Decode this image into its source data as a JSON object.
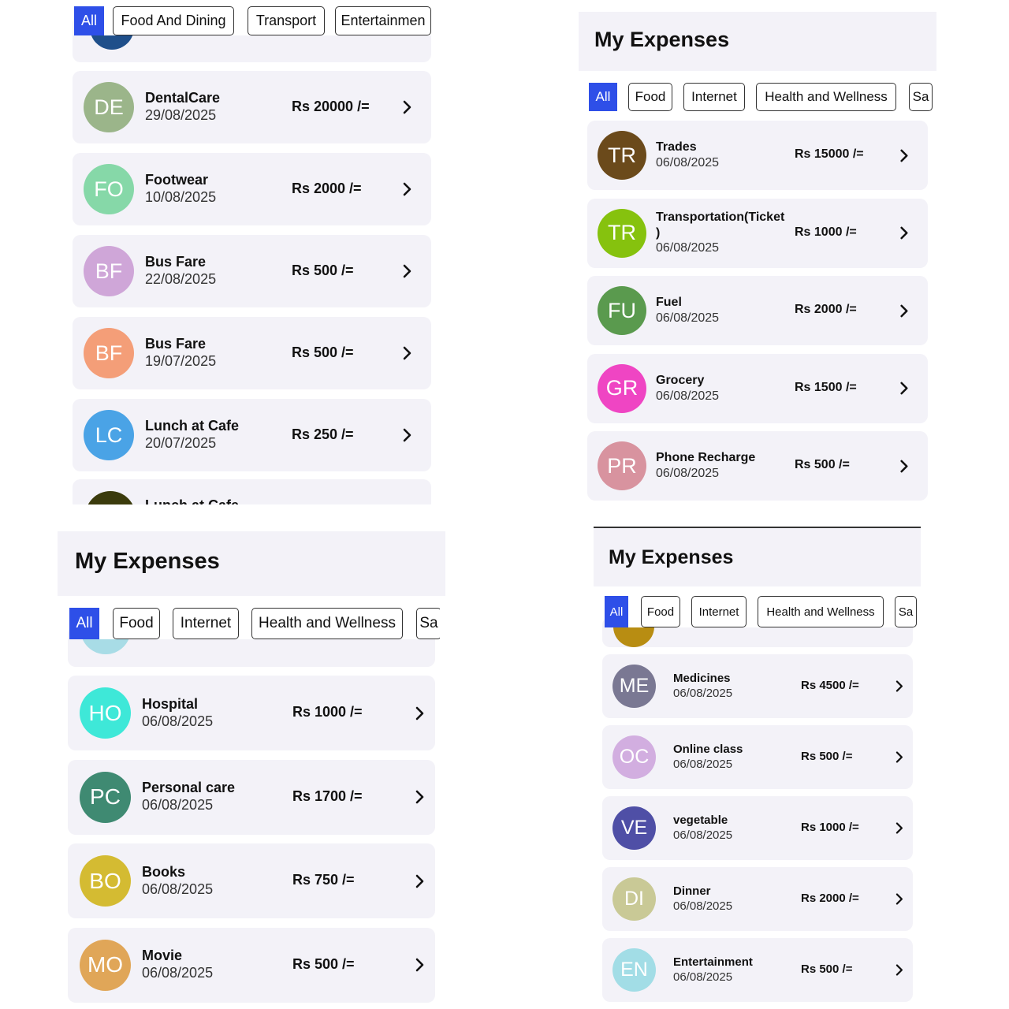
{
  "panel_tl": {
    "filters": [
      {
        "label": "All",
        "active": true
      },
      {
        "label": "Food And Dining",
        "active": false
      },
      {
        "label": "Transport",
        "active": false
      },
      {
        "label": "Entertainmen",
        "active": false
      }
    ],
    "partial_top": {
      "initials": "",
      "color": "#1f4f8a"
    },
    "items": [
      {
        "initials": "DE",
        "color": "#9bb58a",
        "title": "DentalCare",
        "date": "29/08/2025",
        "amount": "Rs 20000 /="
      },
      {
        "initials": "FO",
        "color": "#86d8a8",
        "title": "Footwear",
        "date": "10/08/2025",
        "amount": "Rs 2000 /="
      },
      {
        "initials": "BF",
        "color": "#cfa6d8",
        "title": "Bus Fare",
        "date": "22/08/2025",
        "amount": "Rs 500 /="
      },
      {
        "initials": "BF",
        "color": "#f49e78",
        "title": "Bus Fare",
        "date": "19/07/2025",
        "amount": "Rs 500 /="
      },
      {
        "initials": "LC",
        "color": "#4aa3e6",
        "title": "Lunch at Cafe",
        "date": "20/07/2025",
        "amount": "Rs 250 /="
      }
    ],
    "partial_bottom": {
      "initials": "",
      "color": "#3b3b0c",
      "title": "Lunch at Cafe"
    }
  },
  "panel_tr": {
    "title": "My Expenses",
    "filters": [
      {
        "label": "All",
        "active": true
      },
      {
        "label": "Food",
        "active": false
      },
      {
        "label": "Internet",
        "active": false
      },
      {
        "label": "Health and Wellness",
        "active": false
      },
      {
        "label": "Sa",
        "active": false
      }
    ],
    "items": [
      {
        "initials": "TR",
        "color": "#6b4a1b",
        "title": "Trades",
        "date": "06/08/2025",
        "amount": "Rs 15000 /="
      },
      {
        "initials": "TR",
        "color": "#86c20e",
        "title": "Transportation(Ticket\n)",
        "date": "06/08/2025",
        "amount": "Rs 1000 /="
      },
      {
        "initials": "FU",
        "color": "#5a9a4e",
        "title": "Fuel",
        "date": "06/08/2025",
        "amount": "Rs 2000 /="
      },
      {
        "initials": "GR",
        "color": "#ef45c3",
        "title": "Grocery",
        "date": "06/08/2025",
        "amount": "Rs 1500 /="
      },
      {
        "initials": "PR",
        "color": "#d8939f",
        "title": "Phone Recharge",
        "date": "06/08/2025",
        "amount": "Rs 500 /="
      }
    ]
  },
  "panel_bl": {
    "title": "My Expenses",
    "filters": [
      {
        "label": "All",
        "active": true
      },
      {
        "label": "Food",
        "active": false
      },
      {
        "label": "Internet",
        "active": false
      },
      {
        "label": "Health and Wellness",
        "active": false
      },
      {
        "label": "Sa",
        "active": false
      }
    ],
    "partial_top": {
      "initials": "",
      "color": "#a8dce6"
    },
    "items": [
      {
        "initials": "HO",
        "color": "#3ee8d8",
        "title": "Hospital",
        "date": "06/08/2025",
        "amount": "Rs 1000 /="
      },
      {
        "initials": "PC",
        "color": "#3f8a72",
        "title": "Personal care",
        "date": "06/08/2025",
        "amount": "Rs 1700 /="
      },
      {
        "initials": "BO",
        "color": "#d4bb32",
        "title": "Books",
        "date": "06/08/2025",
        "amount": "Rs 750 /="
      },
      {
        "initials": "MO",
        "color": "#e0a658",
        "title": "Movie",
        "date": "06/08/2025",
        "amount": "Rs 500 /="
      }
    ]
  },
  "panel_br": {
    "title": "My Expenses",
    "filters": [
      {
        "label": "All",
        "active": true
      },
      {
        "label": "Food",
        "active": false
      },
      {
        "label": "Internet",
        "active": false
      },
      {
        "label": "Health and Wellness",
        "active": false
      },
      {
        "label": "Sa",
        "active": false
      }
    ],
    "partial_top": {
      "initials": "",
      "color": "#b88d12"
    },
    "items": [
      {
        "initials": "ME",
        "color": "#7a7893",
        "title": "Medicines",
        "date": "06/08/2025",
        "amount": "Rs 4500 /="
      },
      {
        "initials": "OC",
        "color": "#d2aee0",
        "title": "Online class",
        "date": "06/08/2025",
        "amount": "Rs 500 /="
      },
      {
        "initials": "VE",
        "color": "#4f4fa6",
        "title": "vegetable",
        "date": "06/08/2025",
        "amount": "Rs 1000 /="
      },
      {
        "initials": "DI",
        "color": "#c9c996",
        "title": "Dinner",
        "date": "06/08/2025",
        "amount": "Rs 2000 /="
      },
      {
        "initials": "EN",
        "color": "#a2dde6",
        "title": "Entertainment",
        "date": "06/08/2025",
        "amount": "Rs 500 /="
      }
    ]
  }
}
